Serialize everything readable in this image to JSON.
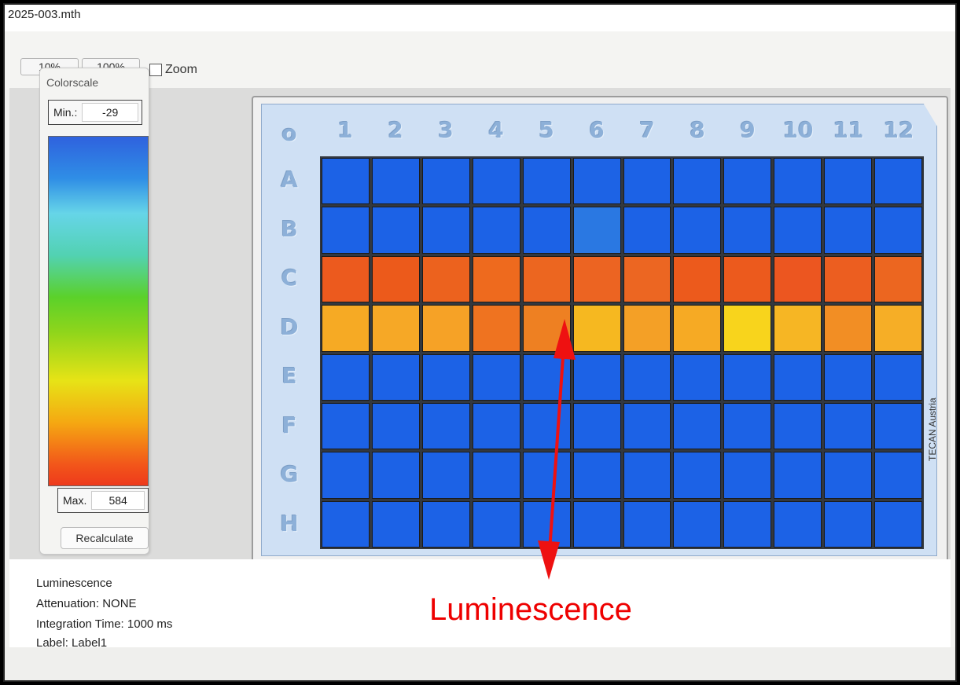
{
  "window": {
    "title": "2025-003.mth"
  },
  "toolbar": {
    "zoom_10": "10%",
    "zoom_100": "100%",
    "zoom_label": "Zoom"
  },
  "colorscale": {
    "title": "Colorscale",
    "min_label": "Min.:",
    "min_value": "-29",
    "max_label": "Max.",
    "max_value": "584",
    "recalculate": "Recalculate",
    "gradient_colors": [
      "#2f62de",
      "#66d5e8",
      "#5bd12a",
      "#e7e316",
      "#ee3a1c"
    ]
  },
  "plate": {
    "corner_label": "o",
    "columns": [
      "1",
      "2",
      "3",
      "4",
      "5",
      "6",
      "7",
      "8",
      "9",
      "10",
      "11",
      "12"
    ],
    "rows": [
      "A",
      "B",
      "C",
      "D",
      "E",
      "F",
      "G",
      "H"
    ],
    "manufacturer": "TECAN Austria",
    "well_colors": {
      "A": [
        "#1c62e6",
        "#1c62e6",
        "#1c62e6",
        "#1c62e6",
        "#1c62e6",
        "#1d63e5",
        "#1c62e6",
        "#1c62e6",
        "#1c62e6",
        "#1c62e6",
        "#1c62e6",
        "#1c62e6"
      ],
      "B": [
        "#1c62e6",
        "#1c62e6",
        "#1c62e6",
        "#1c62e6",
        "#1c62e6",
        "#2a78e2",
        "#1c62e6",
        "#1c62e6",
        "#1c62e6",
        "#1c62e6",
        "#1c62e6",
        "#1c62e6"
      ],
      "C": [
        "#ec5a1e",
        "#ec5a1b",
        "#ec621e",
        "#ee6a1e",
        "#ec6620",
        "#ec6422",
        "#ec6622",
        "#ec5a1c",
        "#ec5a1d",
        "#ec5620",
        "#ec5e20",
        "#ec6620"
      ],
      "D": [
        "#f6aa24",
        "#f6a826",
        "#f6a226",
        "#ef7320",
        "#ee8022",
        "#f6b820",
        "#f4a026",
        "#f6aa24",
        "#f8d41c",
        "#f6b624",
        "#f28e24",
        "#f6ae26"
      ],
      "E": [
        "#1c62e6",
        "#1c62e6",
        "#1c62e6",
        "#1c62e6",
        "#1c62e6",
        "#1c62e6",
        "#1c62e6",
        "#1c62e6",
        "#1c62e6",
        "#1c62e6",
        "#1c62e6",
        "#1c62e6"
      ],
      "F": [
        "#1c62e6",
        "#1c62e6",
        "#1c62e6",
        "#1c62e6",
        "#1c62e6",
        "#1c62e6",
        "#1c62e6",
        "#1c62e6",
        "#1c62e6",
        "#1c62e6",
        "#1c62e6",
        "#1c62e6"
      ],
      "G": [
        "#1c62e6",
        "#1c62e6",
        "#1c62e6",
        "#1c62e6",
        "#1c62e6",
        "#1c62e6",
        "#1c62e6",
        "#1c62e6",
        "#1c62e6",
        "#1c62e6",
        "#1c62e6",
        "#1c62e6"
      ],
      "H": [
        "#1c62e6",
        "#1c62e6",
        "#1c62e6",
        "#1c62e6",
        "#1c62e6",
        "#1c62e6",
        "#1c62e6",
        "#1c62e6",
        "#1c62e6",
        "#1c62e6",
        "#1c62e6",
        "#1c62e6"
      ]
    }
  },
  "info": {
    "mode": "Luminescence",
    "attenuation": "Attenuation: NONE",
    "integration_time": "Integration Time: 1000 ms",
    "label": "Label: Label1"
  },
  "annotation": {
    "text": "Luminescence",
    "color": "#ee0000"
  }
}
